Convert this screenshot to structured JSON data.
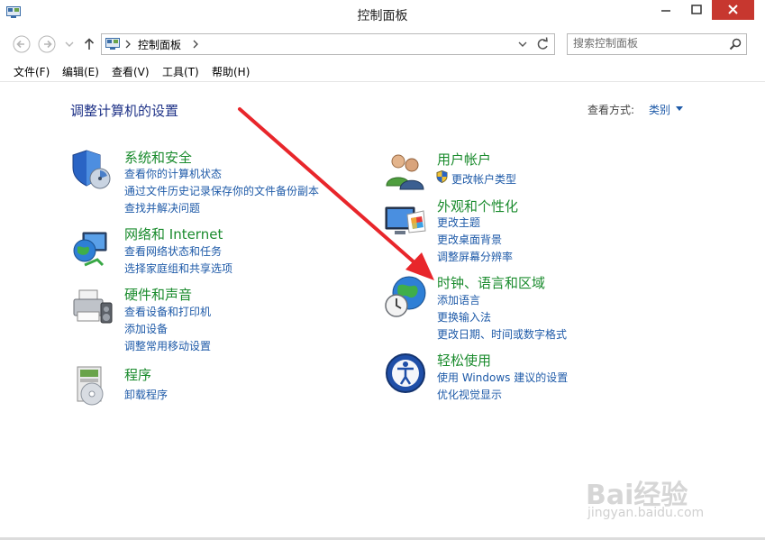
{
  "window": {
    "title": "控制面板"
  },
  "address": {
    "path_item": "控制面板"
  },
  "search": {
    "placeholder": "搜索控制面板"
  },
  "menu": [
    "文件(F)",
    "编辑(E)",
    "查看(V)",
    "工具(T)",
    "帮助(H)"
  ],
  "content": {
    "title": "调整计算机的设置",
    "view_by_label": "查看方式:",
    "view_by_value": "类别"
  },
  "categories": {
    "system_security": {
      "title": "系统和安全",
      "links": [
        "查看你的计算机状态",
        "通过文件历史记录保存你的文件备份副本",
        "查找并解决问题"
      ]
    },
    "network": {
      "title": "网络和 Internet",
      "links": [
        "查看网络状态和任务",
        "选择家庭组和共享选项"
      ]
    },
    "hardware": {
      "title": "硬件和声音",
      "links": [
        "查看设备和打印机",
        "添加设备",
        "调整常用移动设置"
      ]
    },
    "programs": {
      "title": "程序",
      "links": [
        "卸载程序"
      ]
    },
    "user_accounts": {
      "title": "用户帐户",
      "links": [
        "更改帐户类型"
      ]
    },
    "appearance": {
      "title": "外观和个性化",
      "links": [
        "更改主题",
        "更改桌面背景",
        "调整屏幕分辨率"
      ]
    },
    "clock_region": {
      "title": "时钟、语言和区域",
      "links": [
        "添加语言",
        "更换输入法",
        "更改日期、时间或数字格式"
      ]
    },
    "ease_access": {
      "title": "轻松使用",
      "links": [
        "使用 Windows 建议的设置",
        "优化视觉显示"
      ]
    }
  },
  "watermark": {
    "brand": "Bai经验",
    "url": "jingyan.baidu.com"
  },
  "colors": {
    "link": "#1e5aa8",
    "category_title": "#1a8b2d",
    "page_title": "#1e3287",
    "close_button": "#c7372f",
    "arrow": "#e8262b"
  }
}
